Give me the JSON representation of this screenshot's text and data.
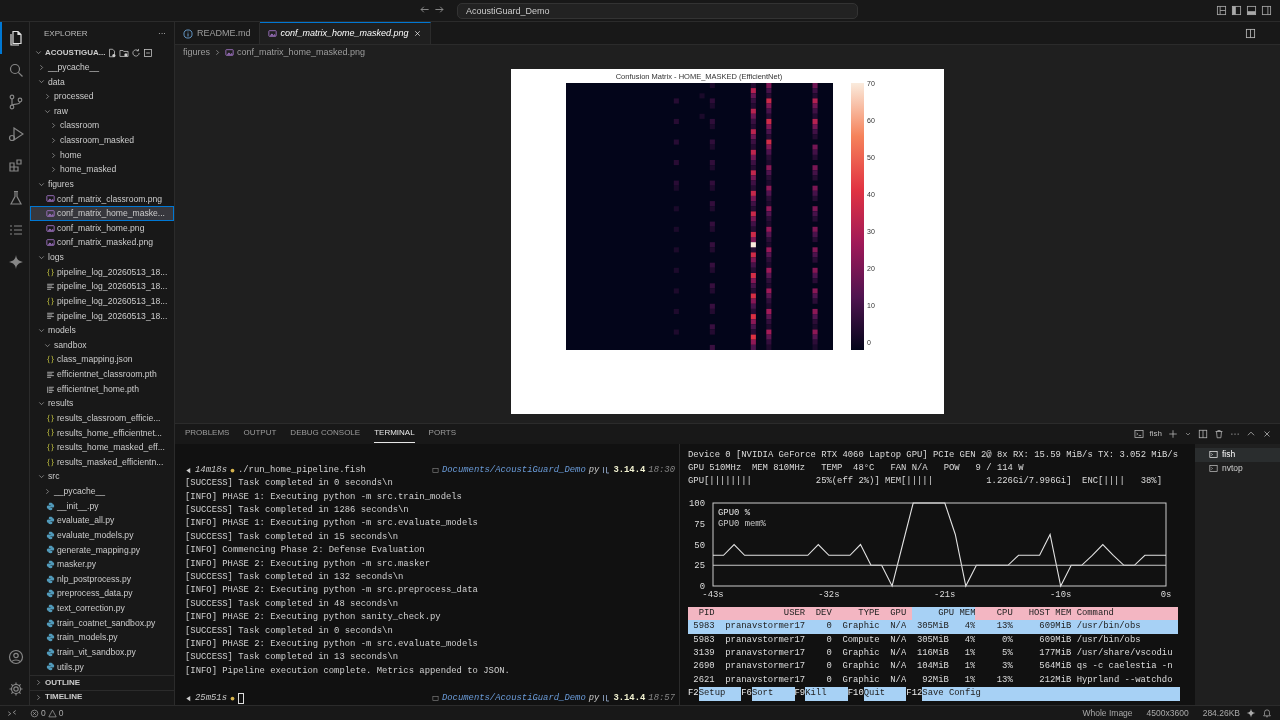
{
  "title_bar": {
    "search": "AcoustiGuard_Demo"
  },
  "activity_bar": {
    "top": [
      {
        "kind": "files",
        "selected": true
      },
      {
        "kind": "search",
        "selected": false
      },
      {
        "kind": "source-control",
        "selected": false
      },
      {
        "kind": "run-debug",
        "selected": false
      },
      {
        "kind": "extensions",
        "selected": false
      },
      {
        "kind": "testing",
        "selected": false
      },
      {
        "kind": "list",
        "selected": false
      },
      {
        "kind": "sparkle",
        "selected": false
      }
    ],
    "bottom": [
      {
        "kind": "account",
        "selected": false
      },
      {
        "kind": "settings",
        "selected": false
      }
    ]
  },
  "explorer": {
    "title": "EXPLORER",
    "more": "···",
    "root": {
      "label": "ACOUSTIGUA...",
      "expanded": true,
      "children": [
        {
          "label": "__pycache__",
          "kind": "folder",
          "expanded": false,
          "selected": false
        },
        {
          "label": "data",
          "kind": "folder",
          "expanded": true,
          "selected": false,
          "children": [
            {
              "label": "processed",
              "kind": "folder",
              "expanded": false,
              "selected": false
            },
            {
              "label": "raw",
              "kind": "folder",
              "expanded": true,
              "selected": false,
              "children": [
                {
                  "label": "classroom",
                  "kind": "folder",
                  "expanded": false,
                  "selected": false
                },
                {
                  "label": "classroom_masked",
                  "kind": "folder",
                  "expanded": false,
                  "selected": false
                },
                {
                  "label": "home",
                  "kind": "folder",
                  "expanded": false,
                  "selected": false
                },
                {
                  "label": "home_masked",
                  "kind": "folder",
                  "expanded": false,
                  "selected": false
                }
              ]
            }
          ]
        },
        {
          "label": "figures",
          "kind": "folder",
          "expanded": true,
          "selected": false,
          "children": [
            {
              "label": "conf_matrix_classroom.png",
              "kind": "image",
              "selected": false
            },
            {
              "label": "conf_matrix_home_maske...",
              "kind": "image",
              "selected": true
            },
            {
              "label": "conf_matrix_home.png",
              "kind": "image",
              "selected": false
            },
            {
              "label": "conf_matrix_masked.png",
              "kind": "image",
              "selected": false
            }
          ]
        },
        {
          "label": "logs",
          "kind": "folder",
          "expanded": true,
          "selected": false,
          "children": [
            {
              "label": "pipeline_log_20260513_18...",
              "kind": "json",
              "selected": false
            },
            {
              "label": "pipeline_log_20260513_18...",
              "kind": "log",
              "selected": false
            },
            {
              "label": "pipeline_log_20260513_18...",
              "kind": "json",
              "selected": false
            },
            {
              "label": "pipeline_log_20260513_18...",
              "kind": "log",
              "selected": false
            }
          ]
        },
        {
          "label": "models",
          "kind": "folder",
          "expanded": true,
          "selected": false,
          "children": [
            {
              "label": "sandbox",
              "kind": "folder",
              "expanded": true,
              "selected": false
            },
            {
              "label": "class_mapping.json",
              "kind": "json",
              "selected": false
            },
            {
              "label": "efficientnet_classroom.pth",
              "kind": "log",
              "selected": false
            },
            {
              "label": "efficientnet_home.pth",
              "kind": "model",
              "selected": false
            }
          ]
        },
        {
          "label": "results",
          "kind": "folder",
          "expanded": true,
          "selected": false,
          "children": [
            {
              "label": "results_classroom_efficie...",
              "kind": "json",
              "selected": false
            },
            {
              "label": "results_home_efficientnet...",
              "kind": "json",
              "selected": false
            },
            {
              "label": "results_home_masked_eff...",
              "kind": "json",
              "selected": false
            },
            {
              "label": "results_masked_efficientn...",
              "kind": "json",
              "selected": false
            }
          ]
        },
        {
          "label": "src",
          "kind": "folder",
          "expanded": true,
          "selected": false,
          "children": [
            {
              "label": "__pycache__",
              "kind": "folder",
              "expanded": false,
              "selected": false
            },
            {
              "label": "__init__.py",
              "kind": "python",
              "selected": false
            },
            {
              "label": "evaluate_all.py",
              "kind": "python",
              "selected": false
            },
            {
              "label": "evaluate_models.py",
              "kind": "python",
              "selected": false
            },
            {
              "label": "generate_mapping.py",
              "kind": "python",
              "selected": false
            },
            {
              "label": "masker.py",
              "kind": "python",
              "selected": false
            },
            {
              "label": "nlp_postprocess.py",
              "kind": "python",
              "selected": false
            },
            {
              "label": "preprocess_data.py",
              "kind": "python",
              "selected": false
            },
            {
              "label": "text_correction.py",
              "kind": "python",
              "selected": false
            },
            {
              "label": "train_coatnet_sandbox.py",
              "kind": "python",
              "selected": false
            },
            {
              "label": "train_models.py",
              "kind": "python",
              "selected": false
            },
            {
              "label": "train_vit_sandbox.py",
              "kind": "python",
              "selected": false
            },
            {
              "label": "utils.py",
              "kind": "python",
              "selected": false
            }
          ]
        }
      ]
    },
    "sections": [
      {
        "label": "OUTLINE",
        "expanded": false
      },
      {
        "label": "TIMELINE",
        "expanded": false
      }
    ]
  },
  "editor_tabs": [
    {
      "label": "README.md",
      "kind": "info",
      "selected": false,
      "preview": false
    },
    {
      "label": "conf_matrix_home_masked.png",
      "kind": "image",
      "selected": true,
      "preview": true
    }
  ],
  "breadcrumb": [
    {
      "label": "figures",
      "kind": "folder"
    },
    {
      "label": "conf_matrix_home_masked.png",
      "kind": "image"
    }
  ],
  "image": {
    "title": "Confusion Matrix - HOME_MASKED (EfficientNet)",
    "colorbar_ticks": [
      "70",
      "60",
      "50",
      "40",
      "30",
      "20",
      "10",
      "0"
    ]
  },
  "panel_tabs": [
    {
      "label": "PROBLEMS",
      "selected": false
    },
    {
      "label": "OUTPUT",
      "selected": false
    },
    {
      "label": "DEBUG CONSOLE",
      "selected": false
    },
    {
      "label": "TERMINAL",
      "selected": true
    },
    {
      "label": "PORTS",
      "selected": false
    }
  ],
  "panel_terminal_label": "fish",
  "terminal": {
    "prompts": [
      {
        "duration": "14m18s",
        "command": "./run_home_pipeline.fish",
        "path": "Documents/AcoustiGuard_Demo",
        "lang": "py",
        "version": "3.14.4",
        "time": "18:30"
      },
      {
        "duration": "25m51s",
        "path": "Documents/AcoustiGuard_Demo",
        "lang": "py",
        "version": "3.14.4",
        "time": "18:57",
        "cursor": true
      }
    ],
    "lines": [
      "[SUCCESS] Task completed in 0 seconds\\n",
      "[INFO] PHASE 1: Executing python -m src.train_models",
      "[SUCCESS] Task completed in 1286 seconds\\n",
      "[INFO] PHASE 1: Executing python -m src.evaluate_models",
      "[SUCCESS] Task completed in 15 seconds\\n",
      "[INFO] Commencing Phase 2: Defense Evaluation",
      "[INFO] PHASE 2: Executing python -m src.masker",
      "[SUCCESS] Task completed in 132 seconds\\n",
      "[INFO] PHASE 2: Executing python -m src.preprocess_data",
      "[SUCCESS] Task completed in 48 seconds\\n",
      "[INFO] PHASE 2: Executing python sanity_check.py",
      "[SUCCESS] Task completed in 0 seconds\\n",
      "[INFO] PHASE 2: Executing python -m src.evaluate_models",
      "[SUCCESS] Task completed in 13 seconds\\n",
      "[INFO] Pipeline execution complete. Metrics appended to JSON."
    ]
  },
  "nvtop": {
    "header": [
      "Device 0 [NVIDIA GeForce RTX 4060 Laptop GPU] PCIe GEN 2@ 8x RX: 15.59 MiB/s TX: 3.052 MiB/s",
      "GPU 510MHz  MEM 810MHz   TEMP  48°C   FAN N/A   POW   9 / 114 W",
      "GPU[||||||||            25%(eff 2%)] MEM[|||||          1.226Gi/7.996Gi]  ENC[||||   38%]"
    ],
    "chart_data": {
      "type": "line",
      "x": [
        -43,
        -42,
        -41,
        -40,
        -39,
        -38,
        -37,
        -36,
        -35,
        -34,
        -33,
        -32,
        -31,
        -30,
        -29,
        -28,
        -27,
        -26,
        -25,
        -24,
        -23,
        -22,
        -21,
        -20,
        -19,
        -18,
        -17,
        -16,
        -15,
        -14,
        -13,
        -12,
        -11,
        -10,
        -9,
        -8,
        -7,
        -6,
        -5,
        -4,
        -3,
        -2,
        -1,
        0
      ],
      "series": [
        {
          "name": "GPU0 %",
          "color": "#e2e2e2",
          "values": [
            37,
            37,
            50,
            37,
            37,
            37,
            37,
            37,
            37,
            37,
            50,
            37,
            37,
            37,
            50,
            25,
            25,
            0,
            50,
            100,
            100,
            100,
            100,
            62,
            0,
            25,
            25,
            25,
            25,
            37,
            37,
            37,
            62,
            0,
            25,
            25,
            37,
            50,
            37,
            25,
            25,
            37,
            37,
            37
          ]
        },
        {
          "name": "GPU0 mem%",
          "color": "#c8c8c8",
          "values": [
            25,
            25,
            25,
            25,
            25,
            25,
            25,
            25,
            25,
            25,
            25,
            25,
            25,
            25,
            25,
            25,
            25,
            25,
            25,
            25,
            25,
            25,
            25,
            25,
            25,
            25,
            25,
            25,
            25,
            25,
            25,
            25,
            25,
            25,
            25,
            25,
            25,
            25,
            25,
            25,
            25,
            25,
            25,
            25
          ]
        }
      ],
      "xlim": [
        -43,
        0
      ],
      "ylim": [
        0,
        100
      ],
      "xticks": [
        {
          "value": -43,
          "label": "-43s"
        },
        {
          "value": -32,
          "label": "-32s"
        },
        {
          "value": -21,
          "label": "-21s"
        },
        {
          "value": -10,
          "label": "-10s"
        },
        {
          "value": 0,
          "label": "0s"
        }
      ],
      "yticks": [
        0,
        25,
        50,
        75,
        100
      ]
    },
    "columns": [
      {
        "label": "PID",
        "sorted": false
      },
      {
        "label": "USER",
        "sorted": false
      },
      {
        "label": "DEV",
        "sorted": false
      },
      {
        "label": "TYPE",
        "sorted": false
      },
      {
        "label": "GPU",
        "sorted": false
      },
      {
        "label": "GPU MEM",
        "sorted": true
      },
      {
        "label": "CPU",
        "sorted": false
      },
      {
        "label": "HOST MEM",
        "sorted": false
      },
      {
        "label": "Command",
        "sorted": false
      }
    ],
    "rows": [
      {
        "selected": true,
        "cells": [
          "5983",
          "pranavstormer17",
          "0",
          "Graphic",
          "N/A",
          "305MiB   4%",
          "13%",
          "609MiB",
          "/usr/bin/obs"
        ]
      },
      {
        "selected": false,
        "cells": [
          "5983",
          "pranavstormer17",
          "0",
          "Compute",
          "N/A",
          "305MiB   4%",
          "0%",
          "609MiB",
          "/usr/bin/obs"
        ]
      },
      {
        "selected": false,
        "cells": [
          "3139",
          "pranavstormer17",
          "0",
          "Graphic",
          "N/A",
          "116MiB   1%",
          "5%",
          "177MiB",
          "/usr/share/vscodiu"
        ]
      },
      {
        "selected": false,
        "cells": [
          "2690",
          "pranavstormer17",
          "0",
          "Graphic",
          "N/A",
          "104MiB   1%",
          "3%",
          "564MiB",
          "qs -c caelestia -n"
        ]
      },
      {
        "selected": false,
        "cells": [
          "2621",
          "pranavstormer17",
          "0",
          "Graphic",
          "N/A",
          "92MiB   1%",
          "13%",
          "212MiB",
          "Hyprland --watchdo"
        ]
      }
    ],
    "keys": [
      {
        "key": "F2",
        "label": "Setup"
      },
      {
        "key": "F6",
        "label": "Sort"
      },
      {
        "key": "F9",
        "label": "Kill"
      },
      {
        "key": "F10",
        "label": "Quit"
      },
      {
        "key": "F12",
        "label": "Save Config"
      }
    ]
  },
  "terminals": [
    {
      "label": "fish",
      "selected": true
    },
    {
      "label": "nvtop",
      "selected": false
    }
  ],
  "status_bar": {
    "errors": "0",
    "warnings": "0",
    "items": [
      "Whole Image",
      "4500x3600",
      "284.26KB"
    ]
  }
}
